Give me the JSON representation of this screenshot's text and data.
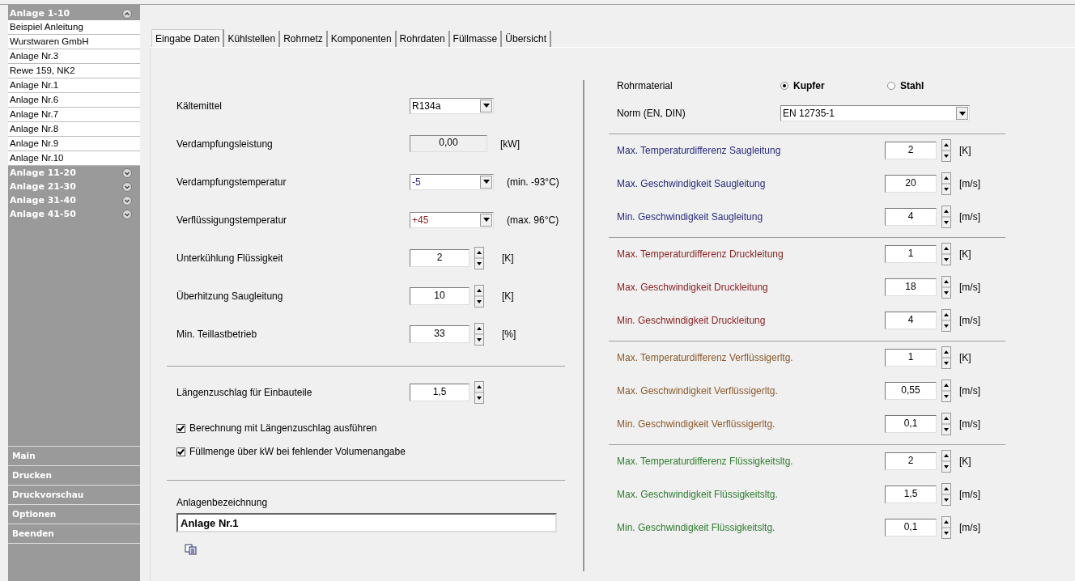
{
  "sidebar": {
    "groups": [
      {
        "title": "Anlage 1-10",
        "expanded": true,
        "items": [
          "Beispiel Anleitung",
          "Wurstwaren GmbH",
          "Anlage Nr.3",
          "Rewe 159, NK2",
          "Anlage Nr.1",
          "Anlage Nr.6",
          "Anlage Nr.7",
          "Anlage Nr.8",
          "Anlage Nr.9",
          "Anlage Nr.10"
        ]
      },
      {
        "title": "Anlage 11-20",
        "expanded": false
      },
      {
        "title": "Anlage 21-30",
        "expanded": false
      },
      {
        "title": "Anlage 31-40",
        "expanded": false
      },
      {
        "title": "Anlage 41-50",
        "expanded": false
      }
    ],
    "menu": [
      "Main",
      "Drucken",
      "Druckvorschau",
      "Optionen",
      "Beenden"
    ]
  },
  "tabs": [
    {
      "label": "Eingabe Daten",
      "selected": true
    },
    {
      "label": "Kühlstellen",
      "selected": false
    },
    {
      "label": "Rohrnetz",
      "selected": false
    },
    {
      "label": "Komponenten",
      "selected": false
    },
    {
      "label": "Rohrdaten",
      "selected": false
    },
    {
      "label": "Füllmasse",
      "selected": false
    },
    {
      "label": "Übersicht",
      "selected": false
    }
  ],
  "inputs": [
    {
      "kind": "dropdown",
      "label": "Kältemittel",
      "value": "R134a"
    },
    {
      "kind": "readonly",
      "label": "Verdampfungsleistung",
      "value": "0,00",
      "unit": "[kW]"
    },
    {
      "kind": "dropdown",
      "label": "Verdampfungstemperatur",
      "value": "-5",
      "unit": "(min. -93°C)",
      "color": "#2a2a80"
    },
    {
      "kind": "dropdown",
      "label": "Verflüssigungstemperatur",
      "value": "+45",
      "unit": "(max. 96°C)",
      "color": "#8b2323"
    },
    {
      "kind": "spinner",
      "label": "Unterkühlung Flüssigkeit",
      "value": "2",
      "unit": "[K]"
    },
    {
      "kind": "spinner",
      "label": "Überhitzung Saugleitung",
      "value": "10",
      "unit": "[K]"
    },
    {
      "kind": "spinner",
      "label": "Min. Teillastbetrieb",
      "value": "33",
      "unit": "[%]"
    }
  ],
  "length_allowance": {
    "label": "Längenzuschlag für Einbauteile",
    "value": "1,5"
  },
  "checkboxes": [
    {
      "label": "Berechnung mit Längenzuschlag ausführen",
      "checked": true
    },
    {
      "label": "Füllmenge über kW bei fehlender Volumenangabe",
      "checked": true
    }
  ],
  "plant_name": {
    "label": "Anlagenbezeichnung",
    "value": "Anlage Nr.1"
  },
  "pipe_material": {
    "label": "Rohrmaterial",
    "options": [
      {
        "label": "Kupfer",
        "selected": true
      },
      {
        "label": "Stahl",
        "selected": false
      }
    ]
  },
  "norm": {
    "label": "Norm (EN, DIN)",
    "value": "EN 12735-1"
  },
  "limits": [
    {
      "color": "#2a2a80",
      "rows": [
        {
          "label": "Max. Temperaturdifferenz Saugleitung",
          "value": "2",
          "unit": "[K]"
        },
        {
          "label": "Max. Geschwindigkeit Saugleitung",
          "value": "20",
          "unit": "[m/s]"
        },
        {
          "label": "Min. Geschwindigkeit Saugleitung",
          "value": "4",
          "unit": "[m/s]"
        }
      ]
    },
    {
      "color": "#8b2323",
      "rows": [
        {
          "label": "Max. Temperaturdifferenz Druckleitung",
          "value": "1",
          "unit": "[K]"
        },
        {
          "label": "Max. Geschwindigkeit Druckleitung",
          "value": "18",
          "unit": "[m/s]"
        },
        {
          "label": "Min. Geschwindigkeit Druckleitung",
          "value": "4",
          "unit": "[m/s]"
        }
      ]
    },
    {
      "color": "#8b5a2b",
      "rows": [
        {
          "label": "Max. Temperaturdifferenz Verflüssigerltg.",
          "value": "1",
          "unit": "[K]"
        },
        {
          "label": "Max. Geschwindigkeit Verflüssigerltg.",
          "value": "0,55",
          "unit": "[m/s]"
        },
        {
          "label": "Min. Geschwindigkeit Verflüssigerltg.",
          "value": "0,1",
          "unit": "[m/s]"
        }
      ]
    },
    {
      "color": "#2e7d2e",
      "rows": [
        {
          "label": "Max. Temperaturdifferenz Flüssigkeitsltg.",
          "value": "2",
          "unit": "[K]"
        },
        {
          "label": "Max. Geschwindigkeit Flüssigkeitsltg.",
          "value": "1,5",
          "unit": "[m/s]"
        },
        {
          "label": "Min. Geschwindigkeit Flüssigkeitsltg.",
          "value": "0,1",
          "unit": "[m/s]"
        }
      ]
    }
  ]
}
